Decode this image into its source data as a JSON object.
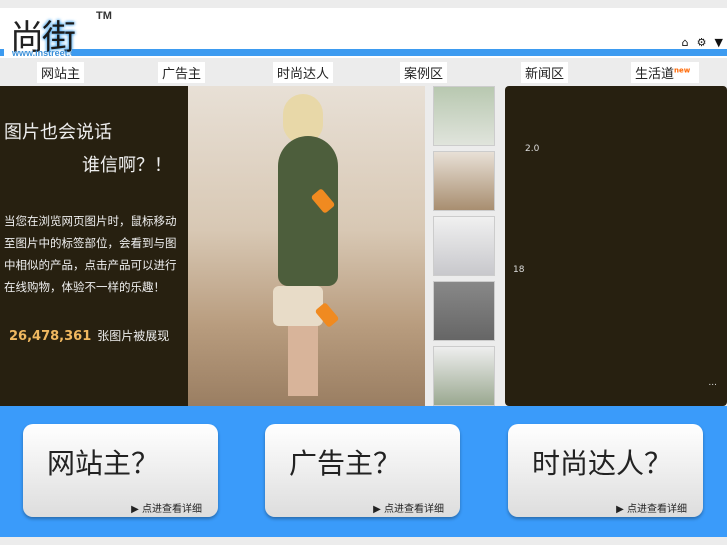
{
  "header": {
    "logo_char1": "尚",
    "logo_char2": "街",
    "trademark": "TM",
    "url": "www.instreet.cn",
    "icons": [
      "home-icon",
      "gear-icon",
      "dropdown-icon"
    ]
  },
  "nav": [
    {
      "label": "网站主"
    },
    {
      "label": "广告主"
    },
    {
      "label": "时尚达人"
    },
    {
      "label": "案例区"
    },
    {
      "label": "新闻区"
    },
    {
      "label": "生活道",
      "badge": "new"
    }
  ],
  "intro": {
    "title1": "图片也会说话",
    "title2": "谁信啊？！",
    "description": "当您在浏览网页图片时，鼠标移动至图片中的标签部位，会看到与图中相似的产品，点击产品可以进行在线购物，体验不一样的乐趣！",
    "count": "26,478,361",
    "count_label": "张图片被展现"
  },
  "side_panel": {
    "label1": "2.0",
    "label2": "18",
    "more": "..."
  },
  "cards": [
    {
      "title": "网站主？",
      "link": "点进查看详细"
    },
    {
      "title": "广告主？",
      "link": "点进查看详细"
    },
    {
      "title": "时尚达人？",
      "link": "点进查看详细"
    }
  ]
}
